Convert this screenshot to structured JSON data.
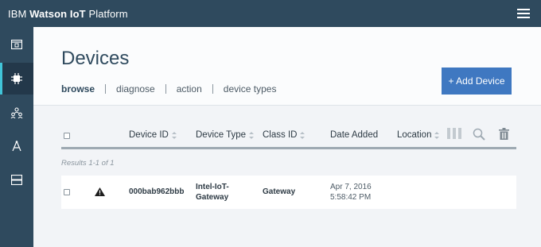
{
  "app": {
    "brand_prefix": "IBM",
    "brand_bold": "Watson IoT",
    "brand_suffix": "Platform"
  },
  "sidebar": {
    "items": [
      {
        "icon": "dashboard-icon"
      },
      {
        "icon": "chip-icon",
        "active": true
      },
      {
        "icon": "members-icon"
      },
      {
        "icon": "rules-icon"
      },
      {
        "icon": "usage-icon"
      }
    ]
  },
  "page": {
    "title": "Devices",
    "tabs": [
      {
        "label": "browse",
        "active": true
      },
      {
        "label": "diagnose"
      },
      {
        "label": "action"
      },
      {
        "label": "device types"
      }
    ],
    "add_button": "+ Add Device"
  },
  "table": {
    "columns": [
      "Device ID",
      "Device Type",
      "Class ID",
      "Date Added",
      "Location"
    ],
    "results_text": "Results 1-1 of 1",
    "rows": [
      {
        "status_icon": "warning-icon",
        "device_id": "000bab962bbb",
        "device_type_line1": "Intel-IoT-",
        "device_type_line2": "Gateway",
        "class_id": "Gateway",
        "date_line1": "Apr 7, 2016",
        "date_line2": "5:58:42 PM",
        "location": ""
      }
    ]
  },
  "colors": {
    "nav": "#2f4a5e",
    "accent": "#41c4d8",
    "button": "#3f78c1"
  }
}
